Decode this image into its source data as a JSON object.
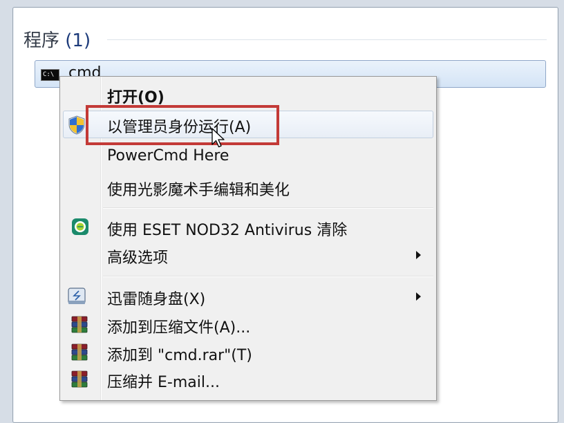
{
  "search_results": {
    "group_title": "程序",
    "group_count": "(1)",
    "item": {
      "icon": "cmd-icon",
      "icon_text": "C:\\",
      "label": "cmd"
    }
  },
  "context_menu": {
    "items": [
      {
        "label": "打开(O)",
        "bold": true
      },
      {
        "label": "以管理员身份运行(A)",
        "icon": "uac-shield-icon",
        "hovered": true
      },
      {
        "label": "PowerCmd Here"
      },
      {
        "label": "使用光影魔术手编辑和美化"
      },
      {
        "label": "使用 ESET NOD32 Antivirus 清除",
        "icon": "eset-icon"
      },
      {
        "label": "高级选项",
        "submenu": true
      },
      {
        "label": "迅雷随身盘(X)",
        "icon": "thunder-disk-icon",
        "submenu": true
      },
      {
        "label": "添加到压缩文件(A)...",
        "icon": "winrar-icon"
      },
      {
        "label": "添加到 \"cmd.rar\"(T)",
        "icon": "winrar-icon"
      },
      {
        "label": "压缩并 E-mail...",
        "icon": "winrar-icon"
      }
    ]
  },
  "annotation": {
    "color": "#c33a37"
  }
}
